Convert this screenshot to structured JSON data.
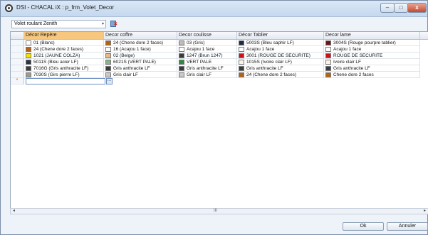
{
  "window": {
    "title": "DSI - CHACAL iX : p_frm_Volet_Decor",
    "controls": {
      "minimize": "–",
      "maximize": "□",
      "close": "x"
    }
  },
  "toolbar": {
    "combo_value": "Volet roulant Zenith",
    "combo_arrow": "▾",
    "delete_icon": "delete-filter-icon"
  },
  "table": {
    "columns": [
      "Décor Repère",
      "Decor coffre",
      "Decor coulisse",
      "Décor Tablier",
      "Decor lame"
    ],
    "rows": [
      [
        {
          "text": "01 (Blanc)",
          "color": "#ffffff"
        },
        {
          "text": "24 (Chene dore 2 faces)",
          "color": "#b8610f"
        },
        {
          "text": "03 (Gris)",
          "color": "#bdbdbd"
        },
        {
          "text": "5003S (Bleu saphir LF)",
          "color": "#1c2a45"
        },
        {
          "text": "3004S (Rouge pourpre tablier)",
          "color": "#6e1317"
        }
      ],
      [
        {
          "text": "24 (Chene dore 2 faces)",
          "color": "#b8610f"
        },
        {
          "text": "16 (Acajou 1 face)",
          "color": "#ffffff"
        },
        {
          "text": "Acajou 1 face",
          "color": "#ffffff"
        },
        {
          "text": "Acajou 1 face",
          "color": "#ffffff"
        },
        {
          "text": "Acajou 1 face",
          "color": "#ffffff"
        }
      ],
      [
        {
          "text": "1021 (JAUNE COLZA)",
          "color": "#f6e100"
        },
        {
          "text": "02 (Beige)",
          "color": "#e9b98a"
        },
        {
          "text": "1247 (Brun 1247)",
          "color": "#3b3a36"
        },
        {
          "text": "3001 (ROUGE DE SECURITE)",
          "color": "#c8141a"
        },
        {
          "text": "ROUGE DE SECURITE",
          "color": "#c8141a"
        }
      ],
      [
        {
          "text": "5011S (Bleu acier LF)",
          "color": "#2a3140"
        },
        {
          "text": "6021S (VERT PALE)",
          "color": "#89b489"
        },
        {
          "text": "VERT PALE",
          "color": "#2e8a3f"
        },
        {
          "text": "1015S (Ivoire clair LF)",
          "color": "#fbf4e6"
        },
        {
          "text": "Ivoire clair LF",
          "color": "#fbf4e6"
        }
      ],
      [
        {
          "text": "7016G (Gris anthracite LF)",
          "color": "#3a3d40"
        },
        {
          "text": "Gris anthracite LF",
          "color": "#3a3d40"
        },
        {
          "text": "Gris anthracite LF",
          "color": "#3a3d40"
        },
        {
          "text": "Gris anthracite LF",
          "color": "#3a3d40"
        },
        {
          "text": "Gris anthracite LF",
          "color": "#3a3d40"
        }
      ],
      [
        {
          "text": "7030S (Girs pierre LF)",
          "color": "#9c9a92"
        },
        {
          "text": "Gris clair LF",
          "color": "#c9c9c9"
        },
        {
          "text": "Gris clair LF",
          "color": "#c9c9c9"
        },
        {
          "text": "24 (Chene dore 2 faces)",
          "color": "#b8610f"
        },
        {
          "text": "Chene dore 2 faces",
          "color": "#b8610f"
        }
      ]
    ],
    "new_row_marker": "*",
    "ellipsis_label": "..."
  },
  "scrollbar": {
    "left_arrow": "◂",
    "right_arrow": "▸",
    "thumb": "III"
  },
  "buttons": {
    "ok": "Ok",
    "cancel": "Annuler"
  }
}
